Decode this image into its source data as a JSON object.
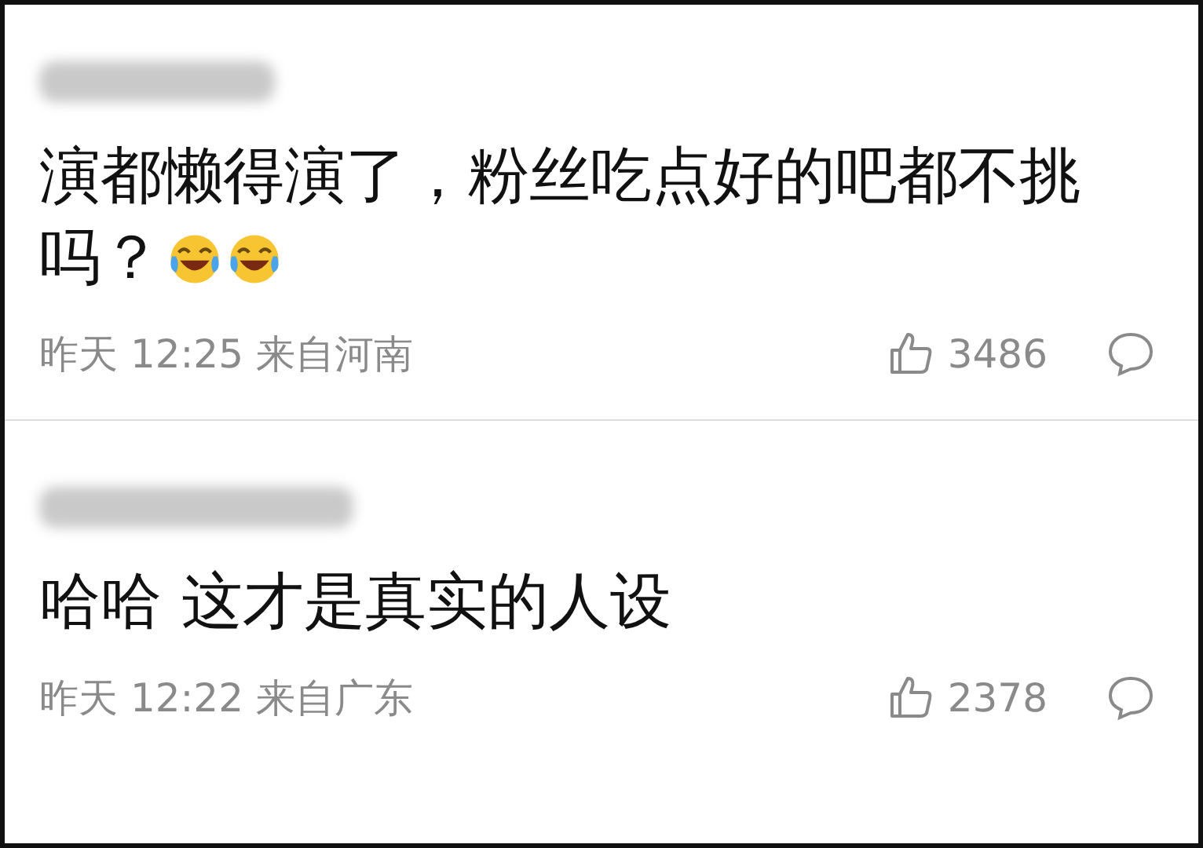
{
  "comments": [
    {
      "text": "演都懒得演了，粉丝吃点好的吧都不挑吗？",
      "emoji": [
        {
          "kind": "laughing"
        },
        {
          "kind": "laughing"
        }
      ],
      "time": "昨天 12:25",
      "location": "来自河南",
      "likes": "3486"
    },
    {
      "text": "哈哈 这才是真实的人设",
      "time": "昨天 12:22",
      "location": "来自广东",
      "likes": "2378"
    }
  ]
}
